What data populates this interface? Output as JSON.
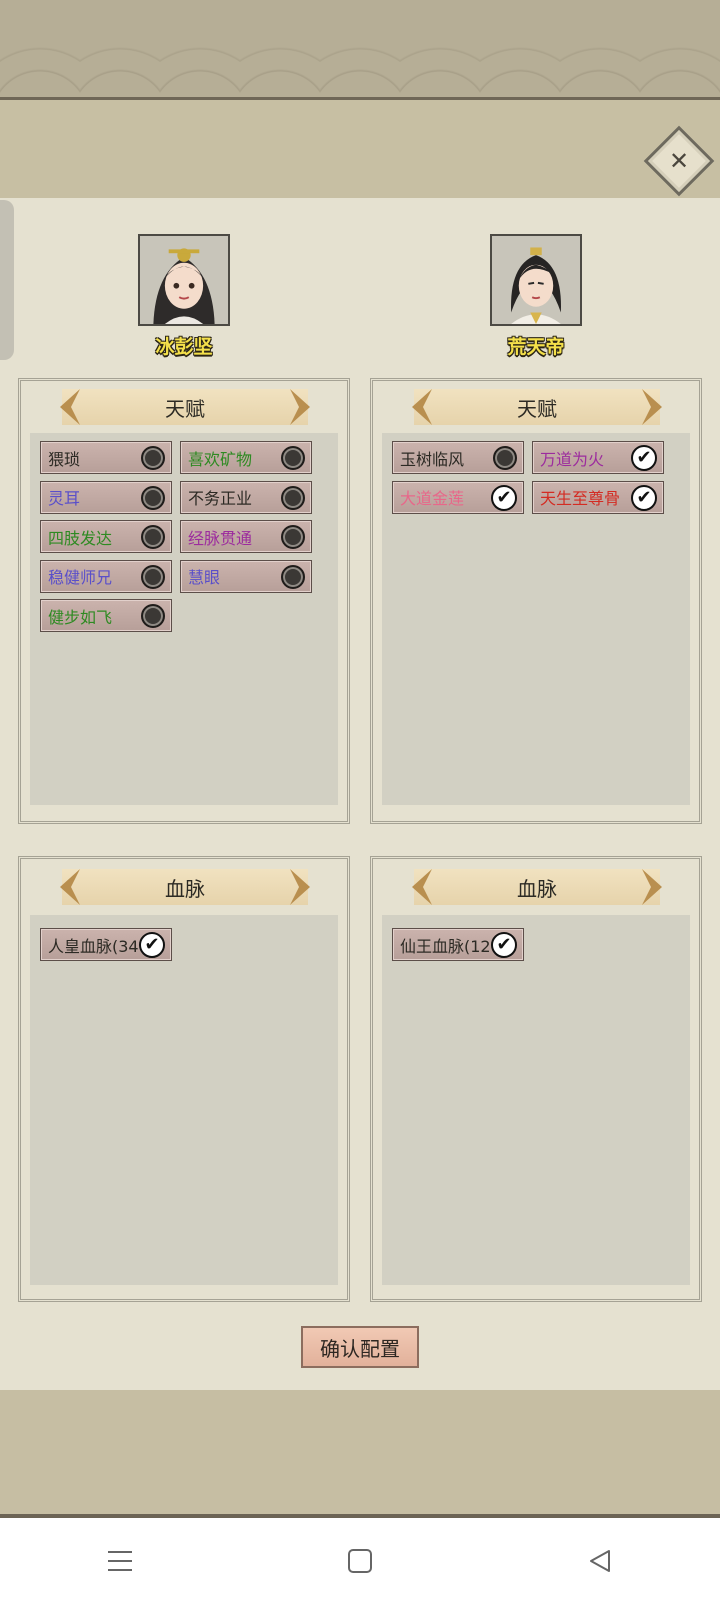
{
  "window": {
    "close_label": "✕"
  },
  "characters": [
    {
      "name": "冰彭坚"
    },
    {
      "name": "荒天帝"
    }
  ],
  "talent_panels": [
    {
      "title": "天赋",
      "items": [
        {
          "label": "猥琐",
          "color": "#2c2a24",
          "selected": false
        },
        {
          "label": "喜欢矿物",
          "color": "#2e8a22",
          "selected": false
        },
        {
          "label": "灵耳",
          "color": "#5a4fc9",
          "selected": false
        },
        {
          "label": "不务正业",
          "color": "#2c2a24",
          "selected": false
        },
        {
          "label": "四肢发达",
          "color": "#2e8a22",
          "selected": false
        },
        {
          "label": "经脉贯通",
          "color": "#9c2c9e",
          "selected": false
        },
        {
          "label": "稳健师兄",
          "color": "#5a4fc9",
          "selected": false
        },
        {
          "label": "慧眼",
          "color": "#5a4fc9",
          "selected": false
        },
        {
          "label": "健步如飞",
          "color": "#2e8a22",
          "selected": false
        }
      ]
    },
    {
      "title": "天赋",
      "items": [
        {
          "label": "玉树临风",
          "color": "#2c2a24",
          "selected": false
        },
        {
          "label": "万道为火",
          "color": "#9c2c9e",
          "selected": true
        },
        {
          "label": "大道金莲",
          "color": "#e8678a",
          "selected": true
        },
        {
          "label": "天生至尊骨",
          "color": "#d42b22",
          "selected": true
        }
      ]
    }
  ],
  "bloodline_panels": [
    {
      "title": "血脉",
      "items": [
        {
          "label": "人皇血脉(34",
          "color": "#2c2a24",
          "selected": true
        }
      ]
    },
    {
      "title": "血脉",
      "items": [
        {
          "label": "仙王血脉(12",
          "color": "#2c2a24",
          "selected": true
        }
      ]
    }
  ],
  "confirm_label": "确认配置",
  "navbar": {
    "icons": [
      "menu-icon",
      "home-square-icon",
      "back-triangle-icon"
    ]
  }
}
